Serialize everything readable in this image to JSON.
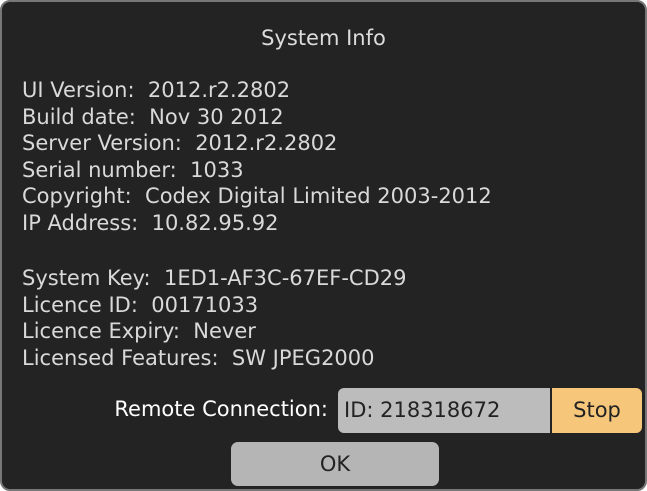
{
  "dialog": {
    "title": "System Info"
  },
  "info": {
    "ui_version": "UI Version:  2012.r2.2802",
    "build_date": "Build date:  Nov 30 2012",
    "server_version": "Server Version:  2012.r2.2802",
    "serial_number": "Serial number:  1033",
    "copyright": "Copyright:  Codex Digital Limited 2003-2012",
    "ip_address": "IP Address:  10.82.95.92"
  },
  "licence": {
    "system_key": "System Key:  1ED1-AF3C-67EF-CD29",
    "licence_id": "Licence ID:  00171033",
    "licence_expiry": "Licence Expiry:  Never",
    "licensed_features": "Licensed Features:  SW JPEG2000"
  },
  "remote": {
    "label": "Remote Connection:",
    "id_value": "ID: 218318672",
    "stop_label": "Stop"
  },
  "actions": {
    "ok_label": "OK"
  },
  "colors": {
    "dialog_background": "#232323",
    "stop_button": "#f6c77b",
    "id_field": "#bcbcbc",
    "ok_button": "#b5b5b5"
  }
}
